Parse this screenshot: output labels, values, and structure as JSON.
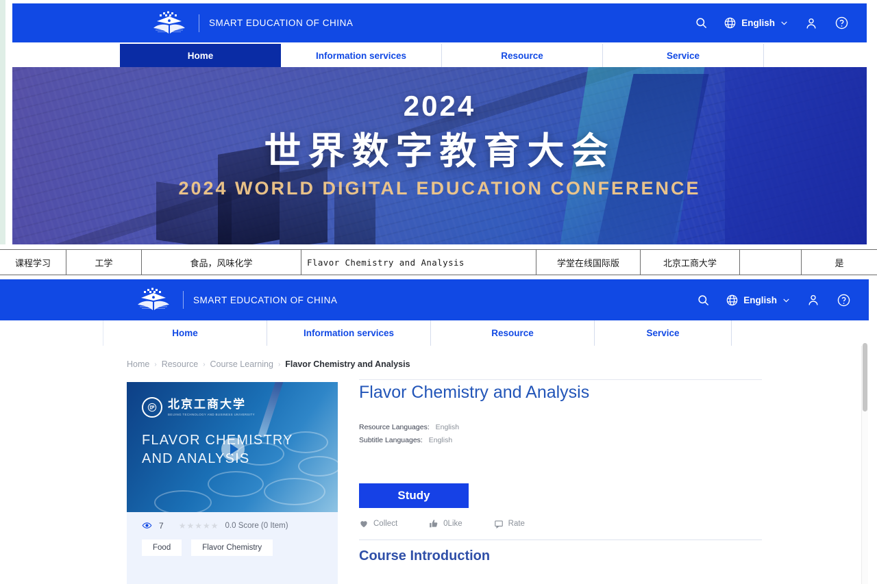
{
  "site": {
    "brand": "SMART EDUCATION OF CHINA",
    "logo_icon": "open-book-crown-logo",
    "accent_blue": "#1149e4",
    "active_nav_blue": "#0a2ca5"
  },
  "header": {
    "search_icon": "search-icon",
    "globe_icon": "globe-icon",
    "language": "English",
    "chevron_icon": "chevron-down-icon",
    "user_icon": "user-icon",
    "help_icon": "question-circle-icon"
  },
  "nav": {
    "items": [
      {
        "label": "Home",
        "active": true
      },
      {
        "label": "Information services",
        "active": false
      },
      {
        "label": "Resource",
        "active": false
      },
      {
        "label": "Service",
        "active": false
      }
    ],
    "bottom_items": [
      {
        "label": "Home",
        "active": false
      },
      {
        "label": "Information services",
        "active": false
      },
      {
        "label": "Resource",
        "active": false
      },
      {
        "label": "Service",
        "active": false
      }
    ]
  },
  "hero": {
    "year": "2024",
    "title_cn": "世界数字教育大会",
    "title_en": "2024 WORLD DIGITAL EDUCATION CONFERENCE"
  },
  "table_row": {
    "cells": [
      "课程学习",
      "工学",
      "食品，风味化学",
      "Flavor Chemistry and Analysis",
      "学堂在线国际版",
      "北京工商大学",
      "",
      "是"
    ]
  },
  "breadcrumb": {
    "items": [
      "Home",
      "Resource",
      "Course Learning",
      "Flavor Chemistry and Analysis"
    ],
    "separator": "›"
  },
  "course": {
    "title": "Flavor Chemistry and Analysis",
    "thumbnail": {
      "university_cn": "北京工商大学",
      "university_en": "BEIJING TECHNOLOGY AND BUSINESS UNIVERSITY",
      "seal_icon": "university-seal-icon",
      "overlay_title": "FLAVOR CHEMISTRY AND ANALYSIS",
      "play_icon": "play-icon"
    },
    "stats": {
      "views_icon": "eye-icon",
      "views": "7",
      "stars": 5,
      "stars_filled": 0,
      "score_text": "0.0 Score  (0 Item)"
    },
    "tags": [
      "Food",
      "Flavor Chemistry"
    ],
    "resource_languages_label": "Resource Languages:",
    "resource_languages_value": "English",
    "subtitle_languages_label": "Subtitle Languages:",
    "subtitle_languages_value": "English",
    "study_button": "Study",
    "actions": [
      {
        "icon": "heart-icon",
        "label": "Collect"
      },
      {
        "icon": "thumbs-up-icon",
        "label": "0Like"
      },
      {
        "icon": "comment-icon",
        "label": "Rate"
      }
    ],
    "section_heading": "Course Introduction"
  }
}
